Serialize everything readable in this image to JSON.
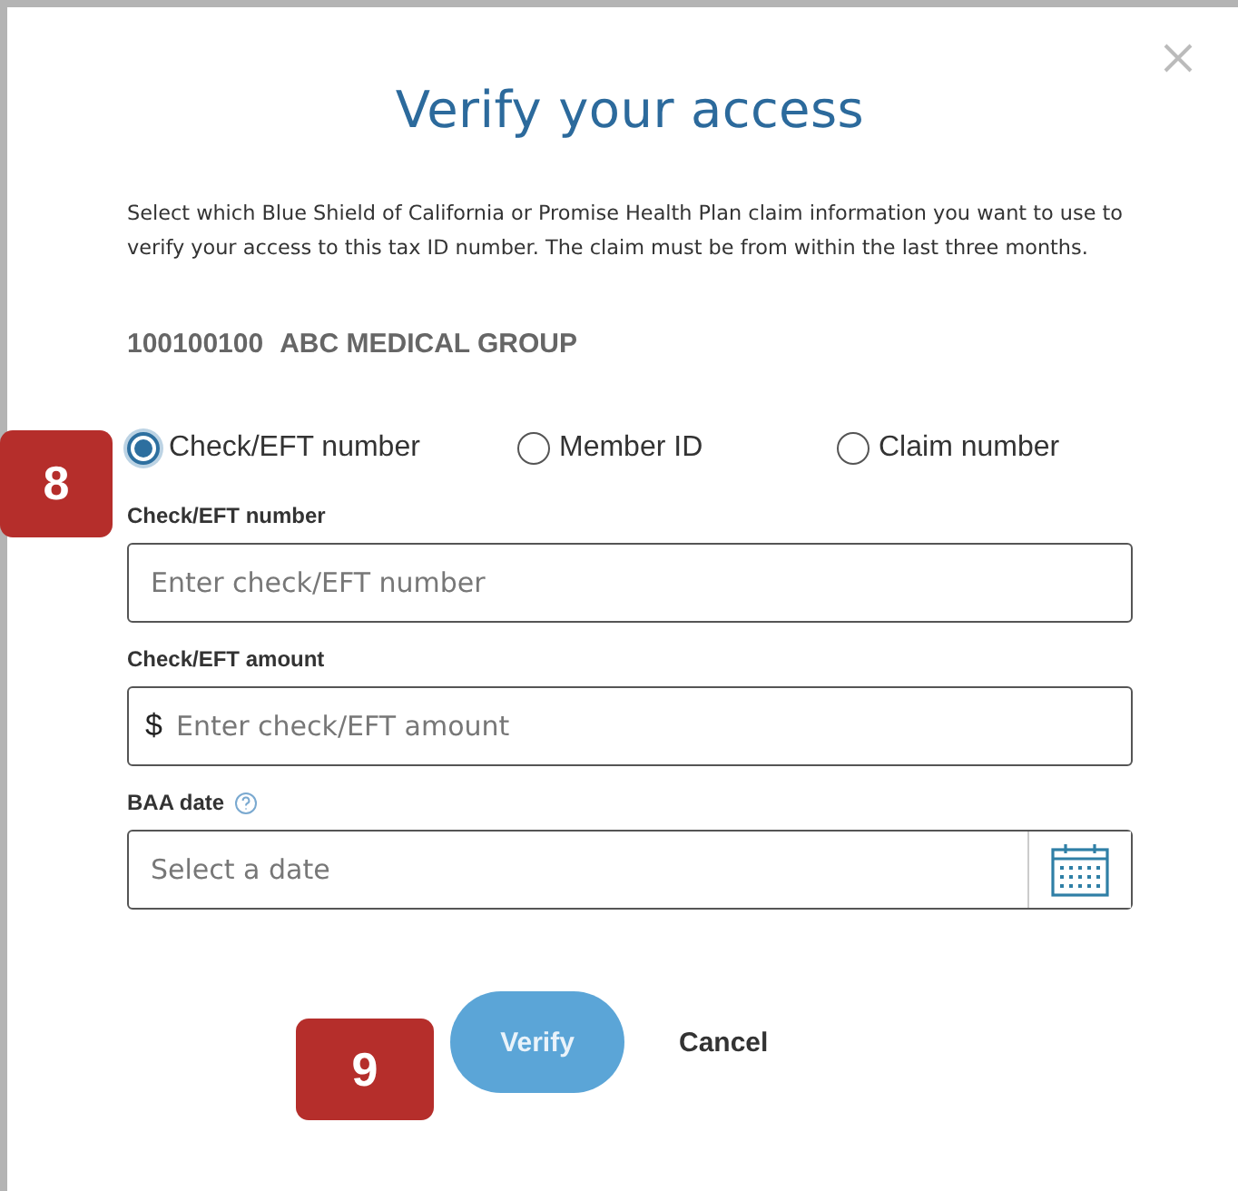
{
  "dialog": {
    "title": "Verify your access",
    "intro": "Select which Blue Shield of California or Promise Health Plan claim information you want to use to verify your access to this tax ID number. The claim must be from within the last three months.",
    "tax_id": "100100100",
    "group_name": "ABC MEDICAL GROUP",
    "options": [
      {
        "label": "Check/EFT number",
        "selected": true
      },
      {
        "label": "Member ID",
        "selected": false
      },
      {
        "label": "Claim number",
        "selected": false
      }
    ],
    "fields": [
      {
        "kind": "text",
        "label": "Check/EFT number",
        "placeholder": "Enter check/EFT number"
      },
      {
        "kind": "currency",
        "label": "Check/EFT amount",
        "prefix": "$",
        "placeholder": "Enter check/EFT amount"
      },
      {
        "kind": "date",
        "label": "BAA date",
        "help": true,
        "placeholder": "Select a date"
      }
    ],
    "buttons": [
      {
        "kind": "primary",
        "label": "Verify"
      },
      {
        "kind": "link",
        "label": "Cancel"
      }
    ]
  },
  "step_badges": [
    {
      "kind": "options",
      "label": "8"
    },
    {
      "kind": "actions",
      "label": "9"
    }
  ]
}
